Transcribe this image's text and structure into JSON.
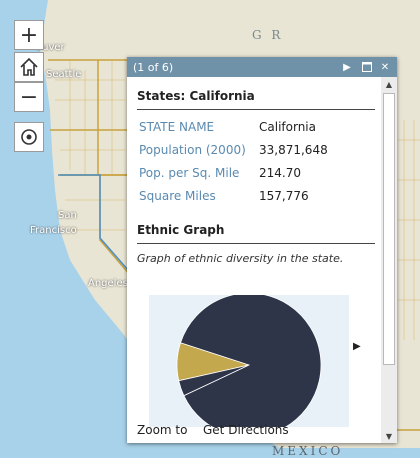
{
  "map": {
    "labels": {
      "vancouver": "ouver",
      "seattle": "Seattle",
      "san_francisco": "San\nFrancisco",
      "los_angeles": "Angeles",
      "mexico": "MEXICO",
      "ocean": "G R"
    },
    "ocean_color": "#a8d2ea",
    "land_color": "#e9e5d4",
    "border_color": "#c9a23c"
  },
  "controls": {
    "zoom_in": "+",
    "zoom_out": "−",
    "home_icon": "home-icon",
    "locate_icon": "locate-icon"
  },
  "popup": {
    "header_title": "(1 of 6)",
    "title": "States: California",
    "fields": [
      {
        "label": "STATE NAME",
        "value": "California"
      },
      {
        "label": "Population (2000)",
        "value": "33,871,648"
      },
      {
        "label": "Pop. per Sq. Mile",
        "value": "214.70"
      },
      {
        "label": "Square Miles",
        "value": "157,776"
      }
    ],
    "media_title": "Ethnic Graph",
    "media_caption": "Graph of ethnic diversity in the state.",
    "zoom_to": "Zoom to",
    "get_directions": "Get Directions"
  },
  "chart_data": {
    "type": "pie",
    "title": "",
    "slices": [
      {
        "value": 0.88,
        "color": "#2e3548"
      },
      {
        "value": 0.085,
        "color": "#c4a84e"
      },
      {
        "value": 0.035,
        "color": "#2e3548"
      }
    ]
  }
}
